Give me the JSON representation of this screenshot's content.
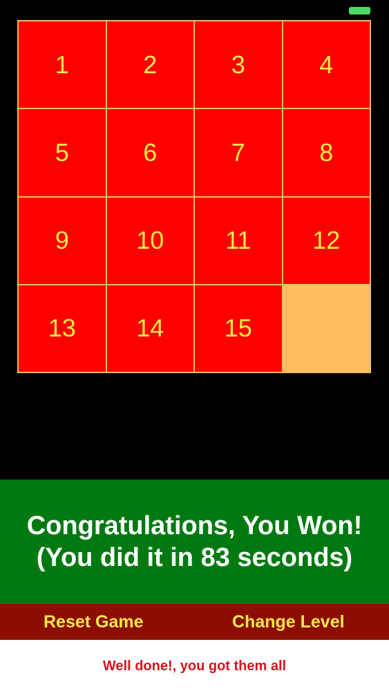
{
  "status_bar": {
    "battery_color": "#4cd964"
  },
  "board": {
    "rows": 4,
    "cols": 4,
    "tile_color": "#ff0000",
    "empty_color": "#ffbd60",
    "number_color": "#ffe94a",
    "tiles": [
      "1",
      "2",
      "3",
      "4",
      "5",
      "6",
      "7",
      "8",
      "9",
      "10",
      "11",
      "12",
      "13",
      "14",
      "15",
      ""
    ]
  },
  "banner": {
    "line1": "Congratulations, You Won!",
    "line2": "(You did it in 83 seconds)",
    "color": "#007a10"
  },
  "controls": {
    "reset_label": "Reset Game",
    "change_level_label": "Change Level",
    "bar_color": "#8c0e00"
  },
  "footer": {
    "message": "Well done!, you got them all"
  }
}
